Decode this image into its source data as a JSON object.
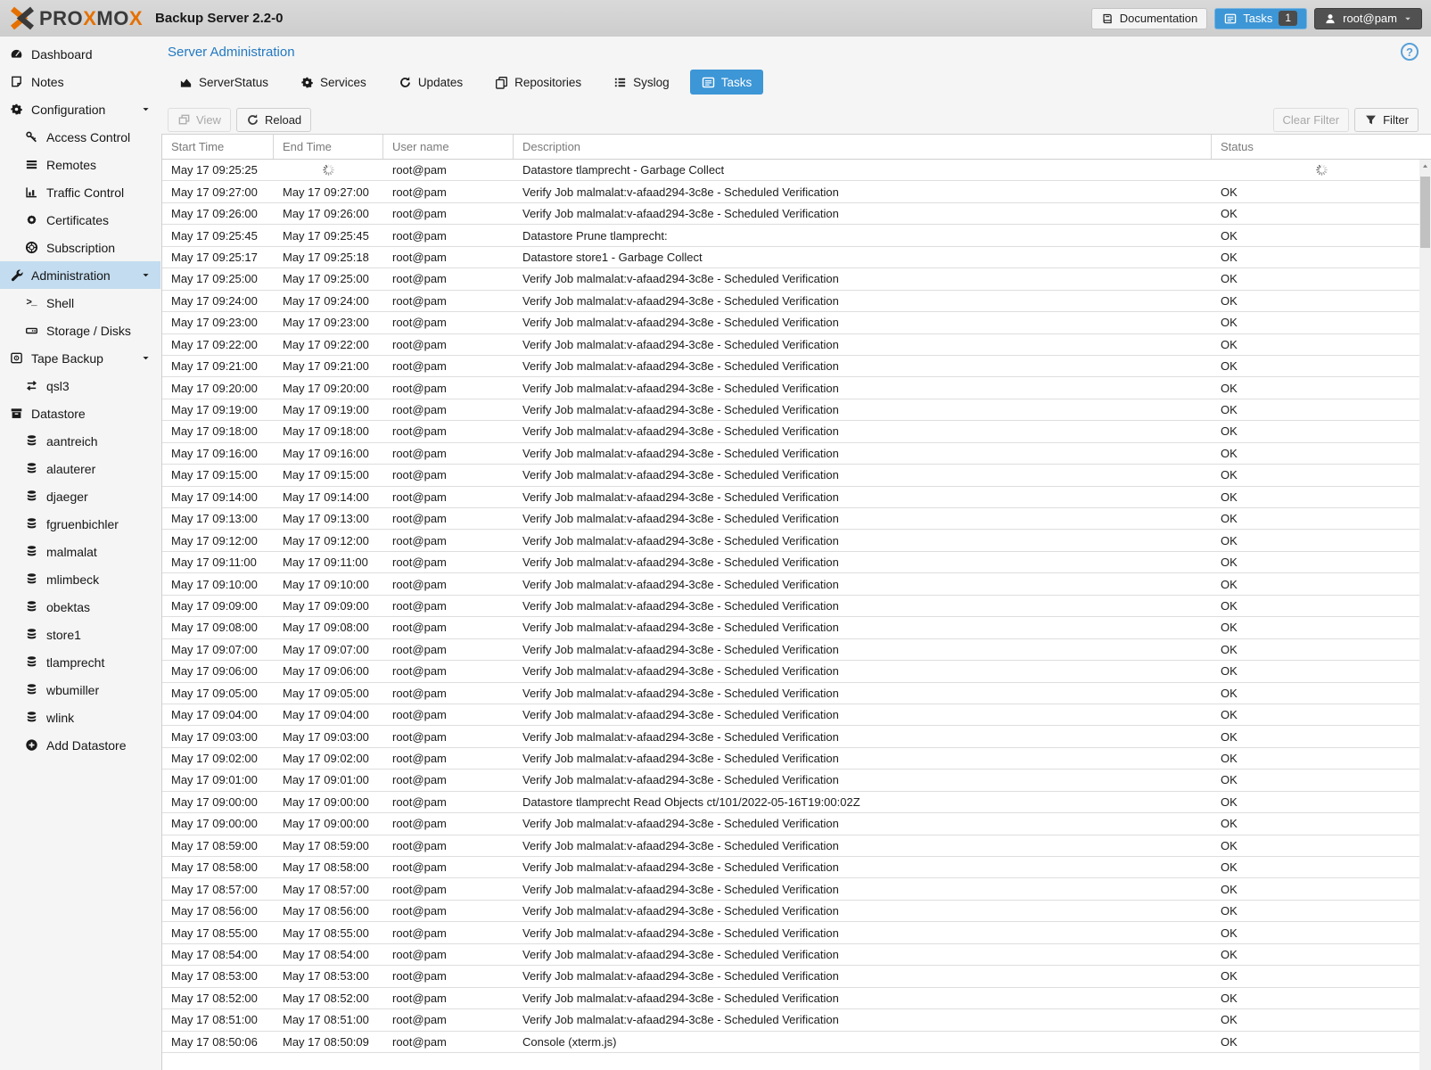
{
  "colors": {
    "accent_blue": "#3d96d6",
    "brand_orange": "#e57000",
    "selected_item_bg": "#c3dcef",
    "topbar_bg": "#d4d4d4",
    "page_bg": "#f5f5f5"
  },
  "topbar": {
    "logo_text": "PROXMOX",
    "product": "Backup Server 2.2-0",
    "documentation_label": "Documentation",
    "tasks_label": "Tasks",
    "tasks_count": "1",
    "user_label": "root@pam"
  },
  "sidebar": {
    "items": [
      {
        "label": "Dashboard",
        "icon": "tachometer-icon",
        "level": 0
      },
      {
        "label": "Notes",
        "icon": "note-icon",
        "level": 0
      },
      {
        "label": "Configuration",
        "icon": "gears-icon",
        "level": 0,
        "expandable": true
      },
      {
        "label": "Access Control",
        "icon": "key-icon",
        "level": 1
      },
      {
        "label": "Remotes",
        "icon": "list-bars-icon",
        "level": 1
      },
      {
        "label": "Traffic Control",
        "icon": "bar-chart-icon",
        "level": 1
      },
      {
        "label": "Certificates",
        "icon": "certificate-icon",
        "level": 1
      },
      {
        "label": "Subscription",
        "icon": "life-ring-icon",
        "level": 1
      },
      {
        "label": "Administration",
        "icon": "wrench-icon",
        "level": 0,
        "expandable": true,
        "selected": true
      },
      {
        "label": "Shell",
        "icon": "terminal-icon",
        "level": 1
      },
      {
        "label": "Storage / Disks",
        "icon": "hdd-icon",
        "level": 1
      },
      {
        "label": "Tape Backup",
        "icon": "tape-icon",
        "level": 0,
        "expandable": true
      },
      {
        "label": "qsl3",
        "icon": "exchange-icon",
        "level": 1
      },
      {
        "label": "Datastore",
        "icon": "archive-icon",
        "level": 0
      },
      {
        "label": "aantreich",
        "icon": "database-icon",
        "level": 1
      },
      {
        "label": "alauterer",
        "icon": "database-icon",
        "level": 1
      },
      {
        "label": "djaeger",
        "icon": "database-icon",
        "level": 1
      },
      {
        "label": "fgruenbichler",
        "icon": "database-icon",
        "level": 1
      },
      {
        "label": "malmalat",
        "icon": "database-icon",
        "level": 1
      },
      {
        "label": "mlimbeck",
        "icon": "database-icon",
        "level": 1
      },
      {
        "label": "obektas",
        "icon": "database-icon",
        "level": 1
      },
      {
        "label": "store1",
        "icon": "database-icon",
        "level": 1
      },
      {
        "label": "tlamprecht",
        "icon": "database-icon",
        "level": 1
      },
      {
        "label": "wbumiller",
        "icon": "database-icon",
        "level": 1
      },
      {
        "label": "wlink",
        "icon": "database-icon",
        "level": 1
      },
      {
        "label": "Add Datastore",
        "icon": "plus-circle-icon",
        "level": 1
      }
    ]
  },
  "content": {
    "title": "Server Administration",
    "help_label": "?",
    "tabs": [
      {
        "label": "ServerStatus",
        "icon": "area-chart-icon"
      },
      {
        "label": "Services",
        "icon": "gears-icon"
      },
      {
        "label": "Updates",
        "icon": "refresh-icon"
      },
      {
        "label": "Repositories",
        "icon": "copy-icon"
      },
      {
        "label": "Syslog",
        "icon": "list-icon"
      },
      {
        "label": "Tasks",
        "icon": "list-alt-icon",
        "active": true
      }
    ],
    "toolbar": {
      "view_label": "View",
      "reload_label": "Reload",
      "clear_filter_label": "Clear Filter",
      "filter_label": "Filter"
    },
    "table": {
      "columns": [
        "Start Time",
        "End Time",
        "User name",
        "Description",
        "Status"
      ],
      "rows": [
        {
          "start": "May 17 09:25:25",
          "end": "",
          "user": "root@pam",
          "desc": "Datastore tlamprecht - Garbage Collect",
          "status": "",
          "running": true
        },
        {
          "start": "May 17 09:27:00",
          "end": "May 17 09:27:00",
          "user": "root@pam",
          "desc": "Verify Job malmalat:v-afaad294-3c8e - Scheduled Verification",
          "status": "OK"
        },
        {
          "start": "May 17 09:26:00",
          "end": "May 17 09:26:00",
          "user": "root@pam",
          "desc": "Verify Job malmalat:v-afaad294-3c8e - Scheduled Verification",
          "status": "OK"
        },
        {
          "start": "May 17 09:25:45",
          "end": "May 17 09:25:45",
          "user": "root@pam",
          "desc": "Datastore Prune tlamprecht:",
          "status": "OK"
        },
        {
          "start": "May 17 09:25:17",
          "end": "May 17 09:25:18",
          "user": "root@pam",
          "desc": "Datastore store1 - Garbage Collect",
          "status": "OK"
        },
        {
          "start": "May 17 09:25:00",
          "end": "May 17 09:25:00",
          "user": "root@pam",
          "desc": "Verify Job malmalat:v-afaad294-3c8e - Scheduled Verification",
          "status": "OK"
        },
        {
          "start": "May 17 09:24:00",
          "end": "May 17 09:24:00",
          "user": "root@pam",
          "desc": "Verify Job malmalat:v-afaad294-3c8e - Scheduled Verification",
          "status": "OK"
        },
        {
          "start": "May 17 09:23:00",
          "end": "May 17 09:23:00",
          "user": "root@pam",
          "desc": "Verify Job malmalat:v-afaad294-3c8e - Scheduled Verification",
          "status": "OK"
        },
        {
          "start": "May 17 09:22:00",
          "end": "May 17 09:22:00",
          "user": "root@pam",
          "desc": "Verify Job malmalat:v-afaad294-3c8e - Scheduled Verification",
          "status": "OK"
        },
        {
          "start": "May 17 09:21:00",
          "end": "May 17 09:21:00",
          "user": "root@pam",
          "desc": "Verify Job malmalat:v-afaad294-3c8e - Scheduled Verification",
          "status": "OK"
        },
        {
          "start": "May 17 09:20:00",
          "end": "May 17 09:20:00",
          "user": "root@pam",
          "desc": "Verify Job malmalat:v-afaad294-3c8e - Scheduled Verification",
          "status": "OK"
        },
        {
          "start": "May 17 09:19:00",
          "end": "May 17 09:19:00",
          "user": "root@pam",
          "desc": "Verify Job malmalat:v-afaad294-3c8e - Scheduled Verification",
          "status": "OK"
        },
        {
          "start": "May 17 09:18:00",
          "end": "May 17 09:18:00",
          "user": "root@pam",
          "desc": "Verify Job malmalat:v-afaad294-3c8e - Scheduled Verification",
          "status": "OK"
        },
        {
          "start": "May 17 09:16:00",
          "end": "May 17 09:16:00",
          "user": "root@pam",
          "desc": "Verify Job malmalat:v-afaad294-3c8e - Scheduled Verification",
          "status": "OK"
        },
        {
          "start": "May 17 09:15:00",
          "end": "May 17 09:15:00",
          "user": "root@pam",
          "desc": "Verify Job malmalat:v-afaad294-3c8e - Scheduled Verification",
          "status": "OK"
        },
        {
          "start": "May 17 09:14:00",
          "end": "May 17 09:14:00",
          "user": "root@pam",
          "desc": "Verify Job malmalat:v-afaad294-3c8e - Scheduled Verification",
          "status": "OK"
        },
        {
          "start": "May 17 09:13:00",
          "end": "May 17 09:13:00",
          "user": "root@pam",
          "desc": "Verify Job malmalat:v-afaad294-3c8e - Scheduled Verification",
          "status": "OK"
        },
        {
          "start": "May 17 09:12:00",
          "end": "May 17 09:12:00",
          "user": "root@pam",
          "desc": "Verify Job malmalat:v-afaad294-3c8e - Scheduled Verification",
          "status": "OK"
        },
        {
          "start": "May 17 09:11:00",
          "end": "May 17 09:11:00",
          "user": "root@pam",
          "desc": "Verify Job malmalat:v-afaad294-3c8e - Scheduled Verification",
          "status": "OK"
        },
        {
          "start": "May 17 09:10:00",
          "end": "May 17 09:10:00",
          "user": "root@pam",
          "desc": "Verify Job malmalat:v-afaad294-3c8e - Scheduled Verification",
          "status": "OK"
        },
        {
          "start": "May 17 09:09:00",
          "end": "May 17 09:09:00",
          "user": "root@pam",
          "desc": "Verify Job malmalat:v-afaad294-3c8e - Scheduled Verification",
          "status": "OK"
        },
        {
          "start": "May 17 09:08:00",
          "end": "May 17 09:08:00",
          "user": "root@pam",
          "desc": "Verify Job malmalat:v-afaad294-3c8e - Scheduled Verification",
          "status": "OK"
        },
        {
          "start": "May 17 09:07:00",
          "end": "May 17 09:07:00",
          "user": "root@pam",
          "desc": "Verify Job malmalat:v-afaad294-3c8e - Scheduled Verification",
          "status": "OK"
        },
        {
          "start": "May 17 09:06:00",
          "end": "May 17 09:06:00",
          "user": "root@pam",
          "desc": "Verify Job malmalat:v-afaad294-3c8e - Scheduled Verification",
          "status": "OK"
        },
        {
          "start": "May 17 09:05:00",
          "end": "May 17 09:05:00",
          "user": "root@pam",
          "desc": "Verify Job malmalat:v-afaad294-3c8e - Scheduled Verification",
          "status": "OK"
        },
        {
          "start": "May 17 09:04:00",
          "end": "May 17 09:04:00",
          "user": "root@pam",
          "desc": "Verify Job malmalat:v-afaad294-3c8e - Scheduled Verification",
          "status": "OK"
        },
        {
          "start": "May 17 09:03:00",
          "end": "May 17 09:03:00",
          "user": "root@pam",
          "desc": "Verify Job malmalat:v-afaad294-3c8e - Scheduled Verification",
          "status": "OK"
        },
        {
          "start": "May 17 09:02:00",
          "end": "May 17 09:02:00",
          "user": "root@pam",
          "desc": "Verify Job malmalat:v-afaad294-3c8e - Scheduled Verification",
          "status": "OK"
        },
        {
          "start": "May 17 09:01:00",
          "end": "May 17 09:01:00",
          "user": "root@pam",
          "desc": "Verify Job malmalat:v-afaad294-3c8e - Scheduled Verification",
          "status": "OK"
        },
        {
          "start": "May 17 09:00:00",
          "end": "May 17 09:00:00",
          "user": "root@pam",
          "desc": "Datastore tlamprecht Read Objects ct/101/2022-05-16T19:00:02Z",
          "status": "OK"
        },
        {
          "start": "May 17 09:00:00",
          "end": "May 17 09:00:00",
          "user": "root@pam",
          "desc": "Verify Job malmalat:v-afaad294-3c8e - Scheduled Verification",
          "status": "OK"
        },
        {
          "start": "May 17 08:59:00",
          "end": "May 17 08:59:00",
          "user": "root@pam",
          "desc": "Verify Job malmalat:v-afaad294-3c8e - Scheduled Verification",
          "status": "OK"
        },
        {
          "start": "May 17 08:58:00",
          "end": "May 17 08:58:00",
          "user": "root@pam",
          "desc": "Verify Job malmalat:v-afaad294-3c8e - Scheduled Verification",
          "status": "OK"
        },
        {
          "start": "May 17 08:57:00",
          "end": "May 17 08:57:00",
          "user": "root@pam",
          "desc": "Verify Job malmalat:v-afaad294-3c8e - Scheduled Verification",
          "status": "OK"
        },
        {
          "start": "May 17 08:56:00",
          "end": "May 17 08:56:00",
          "user": "root@pam",
          "desc": "Verify Job malmalat:v-afaad294-3c8e - Scheduled Verification",
          "status": "OK"
        },
        {
          "start": "May 17 08:55:00",
          "end": "May 17 08:55:00",
          "user": "root@pam",
          "desc": "Verify Job malmalat:v-afaad294-3c8e - Scheduled Verification",
          "status": "OK"
        },
        {
          "start": "May 17 08:54:00",
          "end": "May 17 08:54:00",
          "user": "root@pam",
          "desc": "Verify Job malmalat:v-afaad294-3c8e - Scheduled Verification",
          "status": "OK"
        },
        {
          "start": "May 17 08:53:00",
          "end": "May 17 08:53:00",
          "user": "root@pam",
          "desc": "Verify Job malmalat:v-afaad294-3c8e - Scheduled Verification",
          "status": "OK"
        },
        {
          "start": "May 17 08:52:00",
          "end": "May 17 08:52:00",
          "user": "root@pam",
          "desc": "Verify Job malmalat:v-afaad294-3c8e - Scheduled Verification",
          "status": "OK"
        },
        {
          "start": "May 17 08:51:00",
          "end": "May 17 08:51:00",
          "user": "root@pam",
          "desc": "Verify Job malmalat:v-afaad294-3c8e - Scheduled Verification",
          "status": "OK"
        },
        {
          "start": "May 17 08:50:06",
          "end": "May 17 08:50:09",
          "user": "root@pam",
          "desc": "Console (xterm.js)",
          "status": "OK"
        }
      ]
    }
  }
}
